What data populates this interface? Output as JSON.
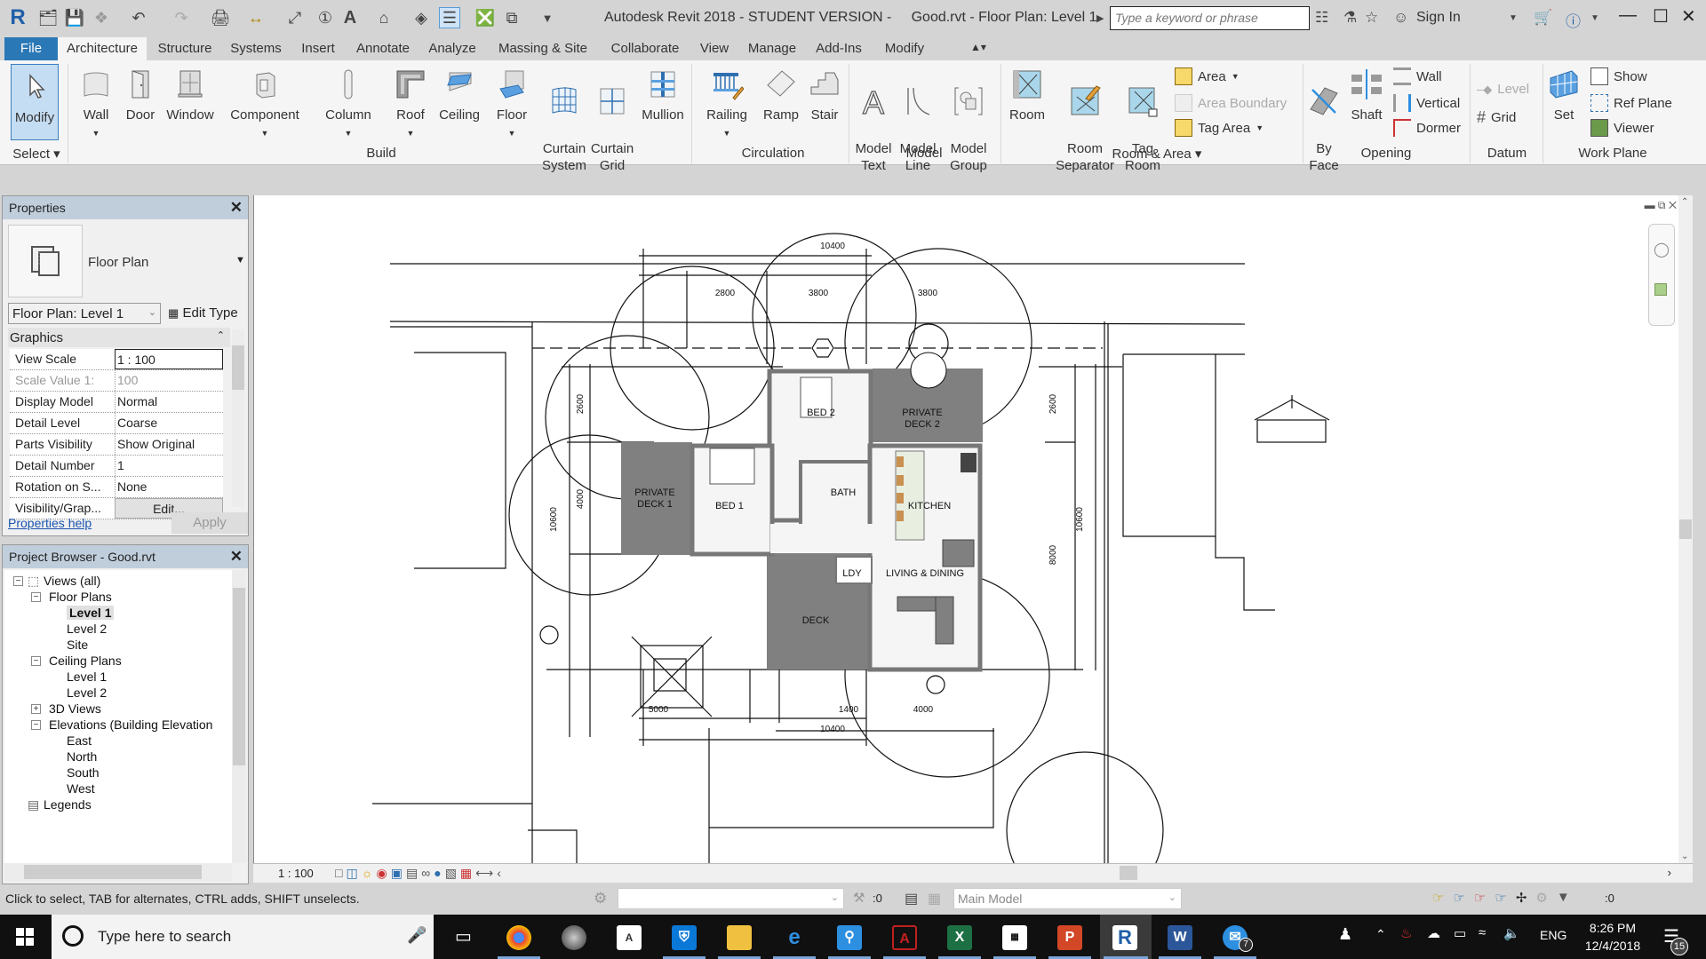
{
  "window": {
    "title": "Autodesk Revit 2018 - STUDENT VERSION -     Good.rvt - Floor Plan: Level 1",
    "search_placeholder": "Type a keyword or phrase",
    "sign_in": "Sign In"
  },
  "quick_access": [
    "revit-logo",
    "open",
    "save",
    "sync",
    "undo",
    "redo",
    "print",
    "measure",
    "align-dimension",
    "tag",
    "text",
    "3d-view",
    "section",
    "thin-lines",
    "close-hidden",
    "switch-windows",
    "customize"
  ],
  "tabs": [
    {
      "label": "File",
      "active": false
    },
    {
      "label": "Architecture",
      "active": true
    },
    {
      "label": "Structure"
    },
    {
      "label": "Systems"
    },
    {
      "label": "Insert"
    },
    {
      "label": "Annotate"
    },
    {
      "label": "Analyze"
    },
    {
      "label": "Massing & Site"
    },
    {
      "label": "Collaborate"
    },
    {
      "label": "View"
    },
    {
      "label": "Manage"
    },
    {
      "label": "Add-Ins"
    },
    {
      "label": "Modify"
    }
  ],
  "ribbon": {
    "select": {
      "modify": "Modify",
      "label": "Select"
    },
    "build": {
      "label": "Build",
      "items": [
        "Wall",
        "Door",
        "Window",
        "Component",
        "Column",
        "Roof",
        "Ceiling",
        "Floor",
        "Curtain\nSystem",
        "Curtain\nGrid",
        "Mullion"
      ]
    },
    "circulation": {
      "label": "Circulation",
      "items": [
        "Railing",
        "Ramp",
        "Stair"
      ]
    },
    "model": {
      "label": "Model",
      "items": [
        "Model\nText",
        "Model\nLine",
        "Model\nGroup"
      ]
    },
    "room_area": {
      "label": "Room & Area",
      "items": [
        "Room",
        "Room\nSeparator",
        "Tag\nRoom"
      ],
      "small": [
        "Area",
        "Area  Boundary",
        "Tag  Area"
      ]
    },
    "opening": {
      "label": "Opening",
      "items": [
        "By\nFace",
        "Shaft"
      ],
      "small": [
        "Wall",
        "Vertical",
        "Dormer"
      ]
    },
    "datum": {
      "label": "Datum",
      "small": [
        "Level",
        "Grid"
      ]
    },
    "work_plane": {
      "label": "Work Plane",
      "items": [
        "Set"
      ],
      "small": [
        "Show",
        "Ref  Plane",
        "Viewer"
      ]
    }
  },
  "properties": {
    "title": "Properties",
    "type_name": "Floor Plan",
    "instance_selector": "Floor Plan: Level 1",
    "edit_type": "Edit Type",
    "section": "Graphics",
    "rows": [
      {
        "key": "View Scale",
        "value": "1 : 100"
      },
      {
        "key": "Scale Value    1:",
        "value": "100"
      },
      {
        "key": "Display Model",
        "value": "Normal"
      },
      {
        "key": "Detail Level",
        "value": "Coarse"
      },
      {
        "key": "Parts Visibility",
        "value": "Show Original"
      },
      {
        "key": "Detail Number",
        "value": "1"
      },
      {
        "key": "Rotation on S...",
        "value": "None"
      },
      {
        "key": "Visibility/Grap...",
        "value": "Edit..."
      }
    ],
    "help_link": "Properties help",
    "apply": "Apply"
  },
  "project_browser": {
    "title": "Project Browser - Good.rvt",
    "tree": [
      {
        "label": "Views (all)",
        "level": 0,
        "toggle": "-"
      },
      {
        "label": "Floor Plans",
        "level": 1,
        "toggle": "-"
      },
      {
        "label": "Level 1",
        "level": 2,
        "selected": true
      },
      {
        "label": "Level 2",
        "level": 2
      },
      {
        "label": "Site",
        "level": 2
      },
      {
        "label": "Ceiling Plans",
        "level": 1,
        "toggle": "-"
      },
      {
        "label": "Level 1",
        "level": 2
      },
      {
        "label": "Level 2",
        "level": 2
      },
      {
        "label": "3D Views",
        "level": 1,
        "toggle": "+"
      },
      {
        "label": "Elevations (Building Elevation",
        "level": 1,
        "toggle": "-"
      },
      {
        "label": "East",
        "level": 2
      },
      {
        "label": "North",
        "level": 2
      },
      {
        "label": "South",
        "level": 2
      },
      {
        "label": "West",
        "level": 2
      },
      {
        "label": "Legends",
        "level": 0
      }
    ]
  },
  "drawing": {
    "rooms": [
      "BED 2",
      "PRIVATE\nDECK 2",
      "PRIVATE\nDECK 1",
      "BED 1",
      "BATH",
      "KITCHEN",
      "LDY",
      "LIVING & DINING",
      "DECK"
    ],
    "dimensions": {
      "top_total": "10400",
      "top_a": "2800",
      "top_b": "3800",
      "top_c": "3800",
      "left_total": "10600",
      "left_a": "2600",
      "left_b": "4000",
      "right_total": "10600",
      "right_a": "2600",
      "right_b": "8000",
      "bottom_a": "5000",
      "bottom_b": "1400",
      "bottom_c": "4000",
      "bottom_total": "10400"
    }
  },
  "view_control": {
    "scale": "1 : 100"
  },
  "status": {
    "message": "Click to select, TAB for alternates, CTRL adds, SHIFT unselects.",
    "worksets_count": ":0",
    "design_option": "Main Model",
    "filter_count": ":0"
  },
  "taskbar": {
    "search_placeholder": "Type here to search",
    "language": "ENG",
    "time": "8:26 PM",
    "date": "12/4/2018",
    "notifications": "15",
    "messenger_badge": "7"
  }
}
